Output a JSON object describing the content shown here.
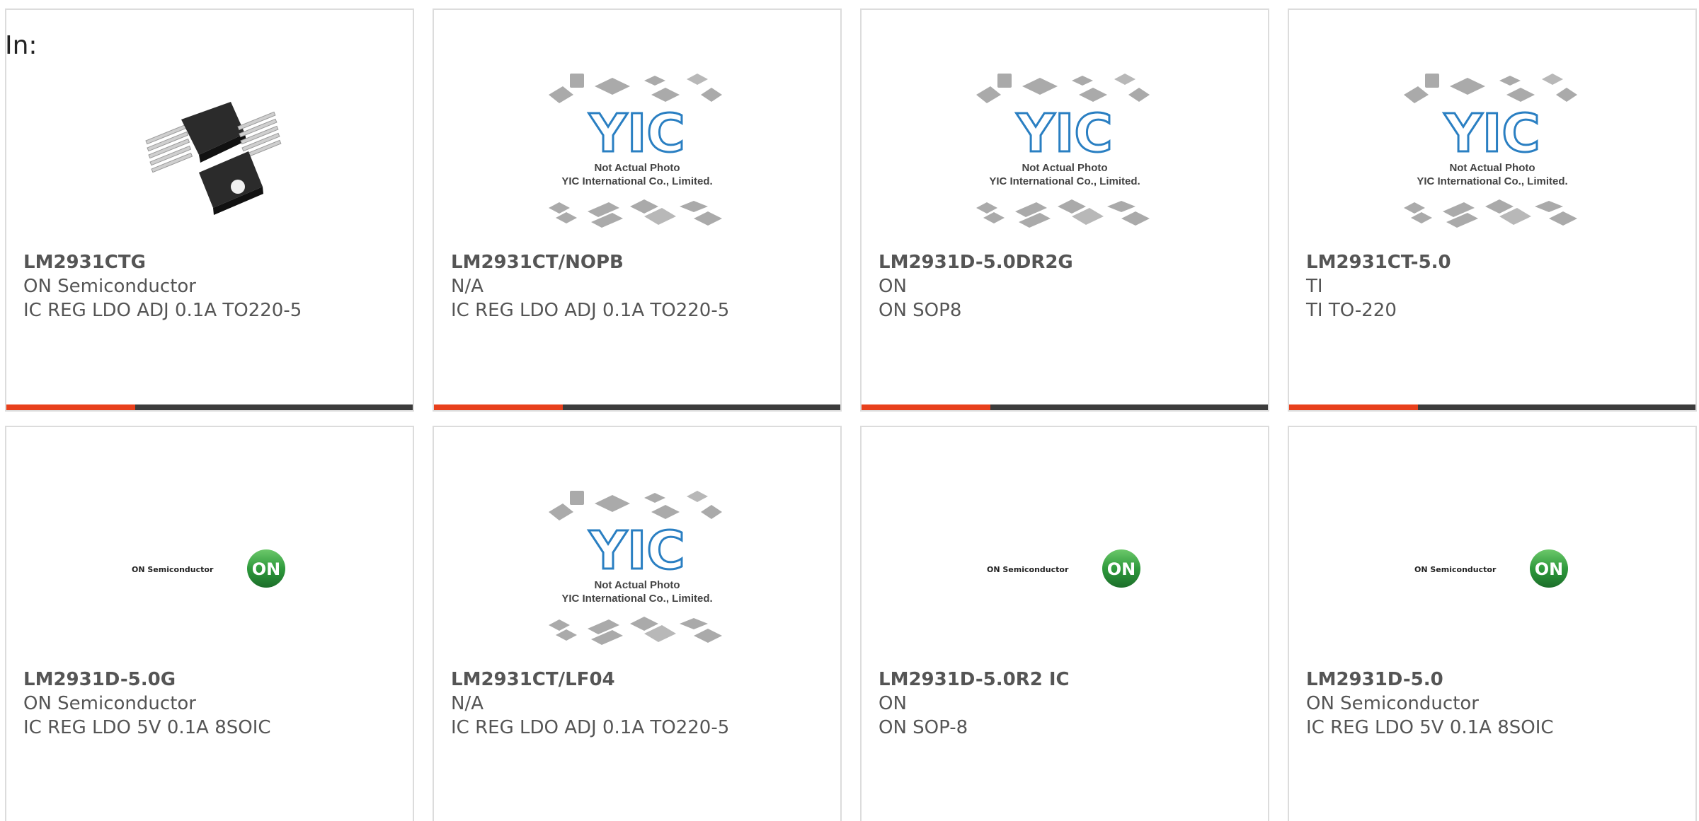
{
  "header": {
    "filter_label": "In:"
  },
  "colors": {
    "accent": "#e8401c",
    "bar": "#3c3c3c",
    "border": "#dcdcdc",
    "text": "#555555",
    "on_logo_green": "#2e9a3c"
  },
  "placeholder": {
    "line1": "Not Actual Photo",
    "line2": "YIC International Co., Limited.",
    "logo_text": "YIC"
  },
  "on_logo": {
    "wordmark": "ON Semiconductor",
    "badge": "ON"
  },
  "products": [
    {
      "part": "LM2931CTG",
      "maker": "ON Semiconductor",
      "desc": "IC REG LDO ADJ 0.1A TO220-5",
      "image": "to220-package-photo"
    },
    {
      "part": "LM2931CT/NOPB",
      "maker": "N/A",
      "desc": "IC REG LDO ADJ 0.1A TO220-5",
      "image": "yic-not-actual-photo"
    },
    {
      "part": "LM2931D-5.0DR2G",
      "maker": "ON",
      "desc": "ON SOP8",
      "image": "yic-not-actual-photo"
    },
    {
      "part": "LM2931CT-5.0",
      "maker": "TI",
      "desc": "TI TO-220",
      "image": "yic-not-actual-photo"
    },
    {
      "part": "LM2931D-5.0G",
      "maker": "ON Semiconductor",
      "desc": "IC REG LDO 5V 0.1A 8SOIC",
      "image": "on-semiconductor-logo"
    },
    {
      "part": "LM2931CT/LF04",
      "maker": "N/A",
      "desc": "IC REG LDO ADJ 0.1A TO220-5",
      "image": "yic-not-actual-photo"
    },
    {
      "part": "LM2931D-5.0R2 IC",
      "maker": "ON",
      "desc": "ON SOP-8",
      "image": "on-semiconductor-logo"
    },
    {
      "part": "LM2931D-5.0",
      "maker": "ON Semiconductor",
      "desc": "IC REG LDO 5V 0.1A 8SOIC",
      "image": "on-semiconductor-logo"
    }
  ]
}
